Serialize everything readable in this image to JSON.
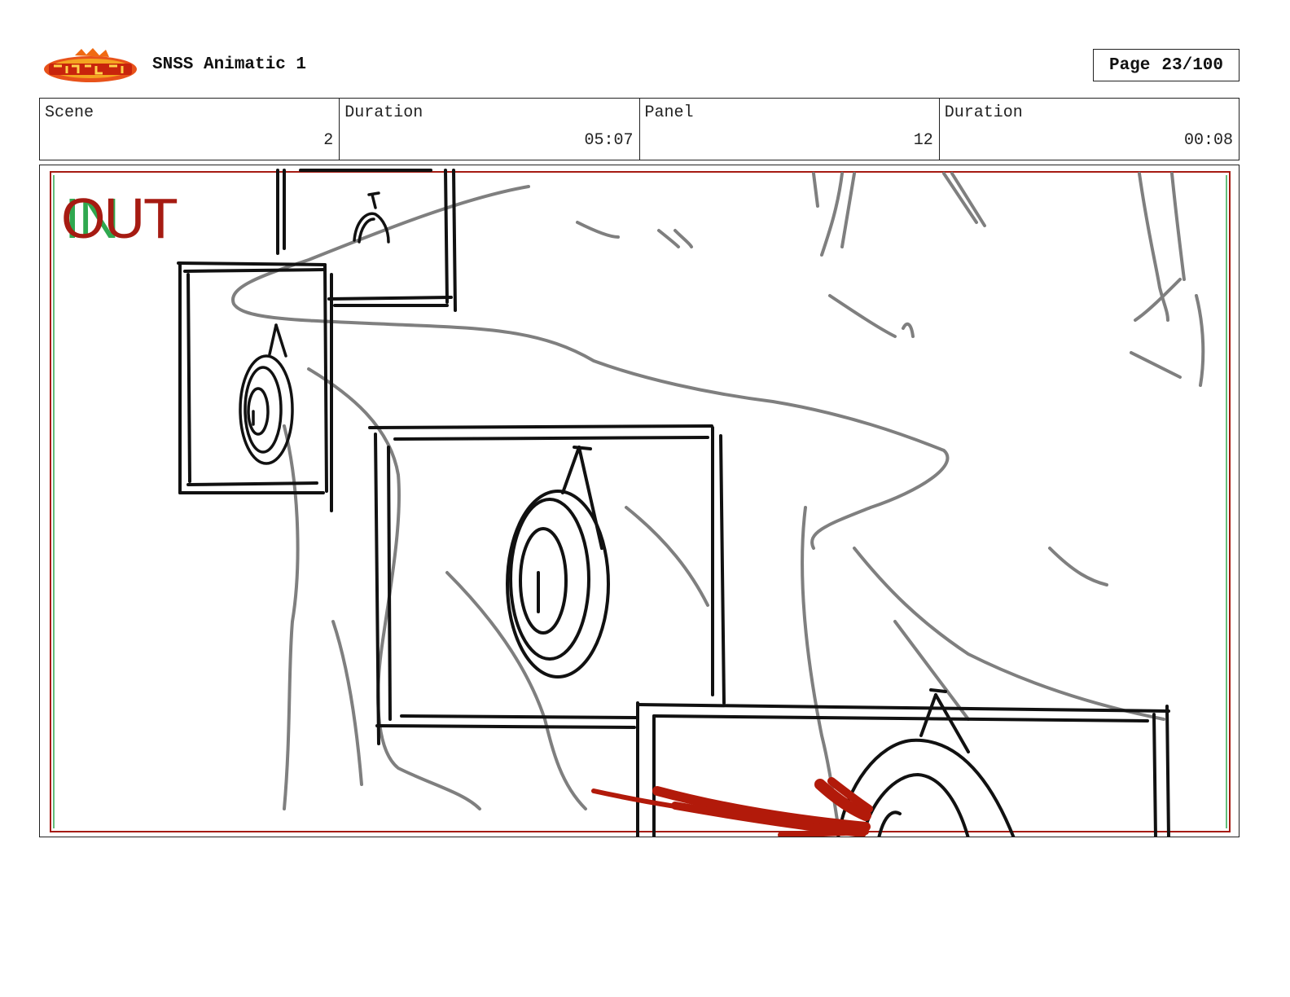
{
  "header": {
    "title": "SNSS Animatic 1",
    "page_label": "Page",
    "page_value": "23/100",
    "logo_icon": "show-logo-icon"
  },
  "info": {
    "scene_label": "Scene",
    "scene_value": "2",
    "scene_duration_label": "Duration",
    "scene_duration_value": "05:07",
    "panel_label": "Panel",
    "panel_value": "12",
    "panel_duration_label": "Duration",
    "panel_duration_value": "00:08"
  },
  "panel": {
    "in_marker": "IN",
    "out_marker": "OUT",
    "colors": {
      "safe_frame": "#a61b12",
      "in_marker": "#2fa84f",
      "sketch_gray": "#7f7f7f",
      "red_stroke": "#b21a0a"
    }
  }
}
